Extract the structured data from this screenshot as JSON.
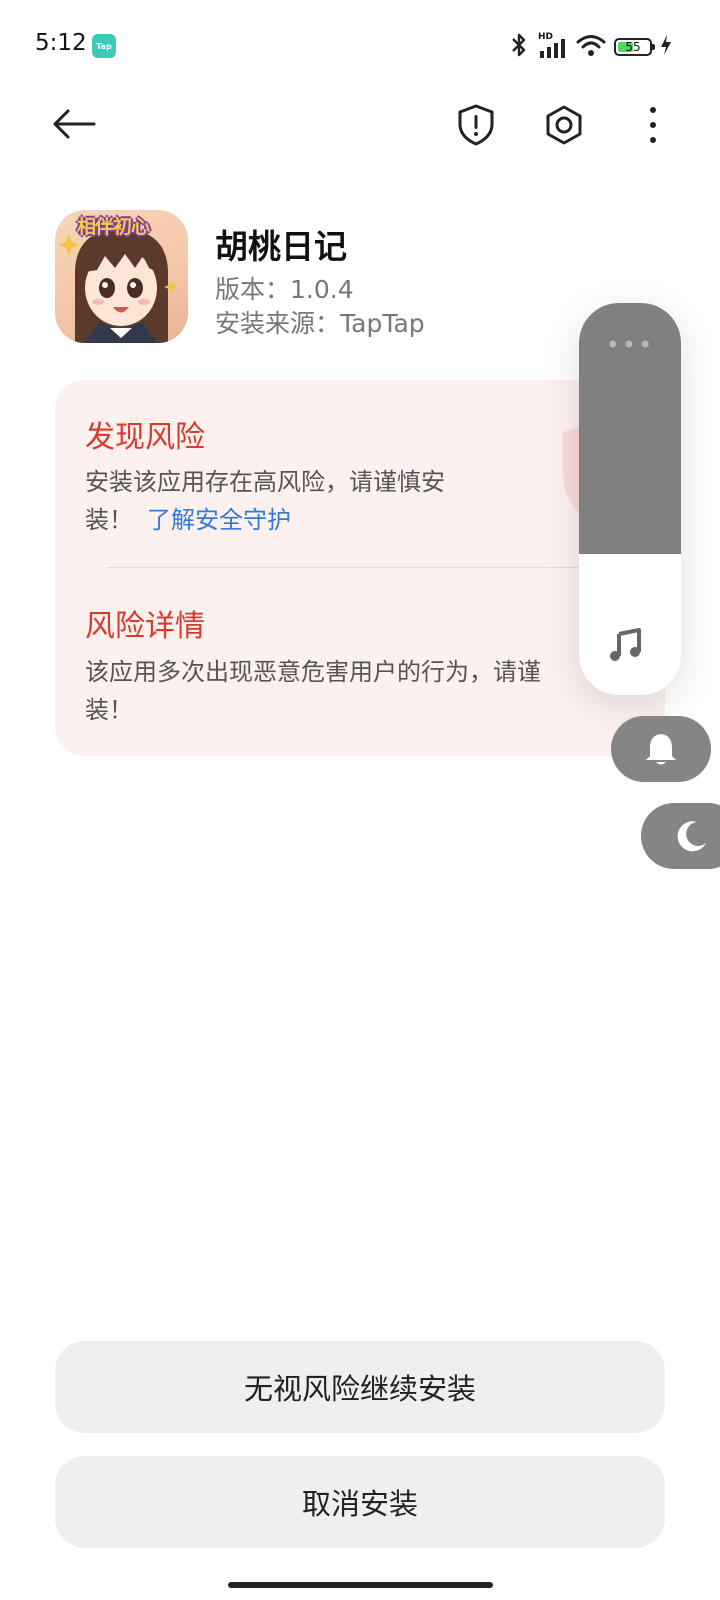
{
  "status_bar": {
    "time": "5:12",
    "app_badge": "Tap",
    "network_label": "HD",
    "battery_level": "55",
    "icons": [
      "bluetooth-icon",
      "signal-icon",
      "wifi-icon",
      "battery-icon",
      "charging-icon"
    ]
  },
  "nav": {
    "icons": [
      "back-arrow-icon",
      "shield-alert-icon",
      "settings-icon",
      "more-icon"
    ]
  },
  "app": {
    "name": "胡桃日记",
    "version": "版本：1.0.4",
    "source": "安装来源：TapTap",
    "icon_text": "相伴初心"
  },
  "risk": {
    "title": "发现风险",
    "description_line1": "安装该应用存在高风险，请谨慎安",
    "description_line2": "装！",
    "link": "了解安全守护",
    "details_title": "风险详情",
    "details_line1": "该应用多次出现恶意危害用户的行为，请谨",
    "details_line2": "装！"
  },
  "overlay": {
    "volume_fraction": 0.64,
    "icons": [
      "music-note-icon",
      "bell-icon",
      "moon-icon"
    ]
  },
  "buttons": {
    "continue_install": "无视风险继续安装",
    "cancel_install": "取消安装"
  },
  "colors": {
    "risk_red": "#d83a2d",
    "link_blue": "#2f7ad8",
    "card_bg": "#fdf1f0",
    "button_bg": "#efefef"
  }
}
